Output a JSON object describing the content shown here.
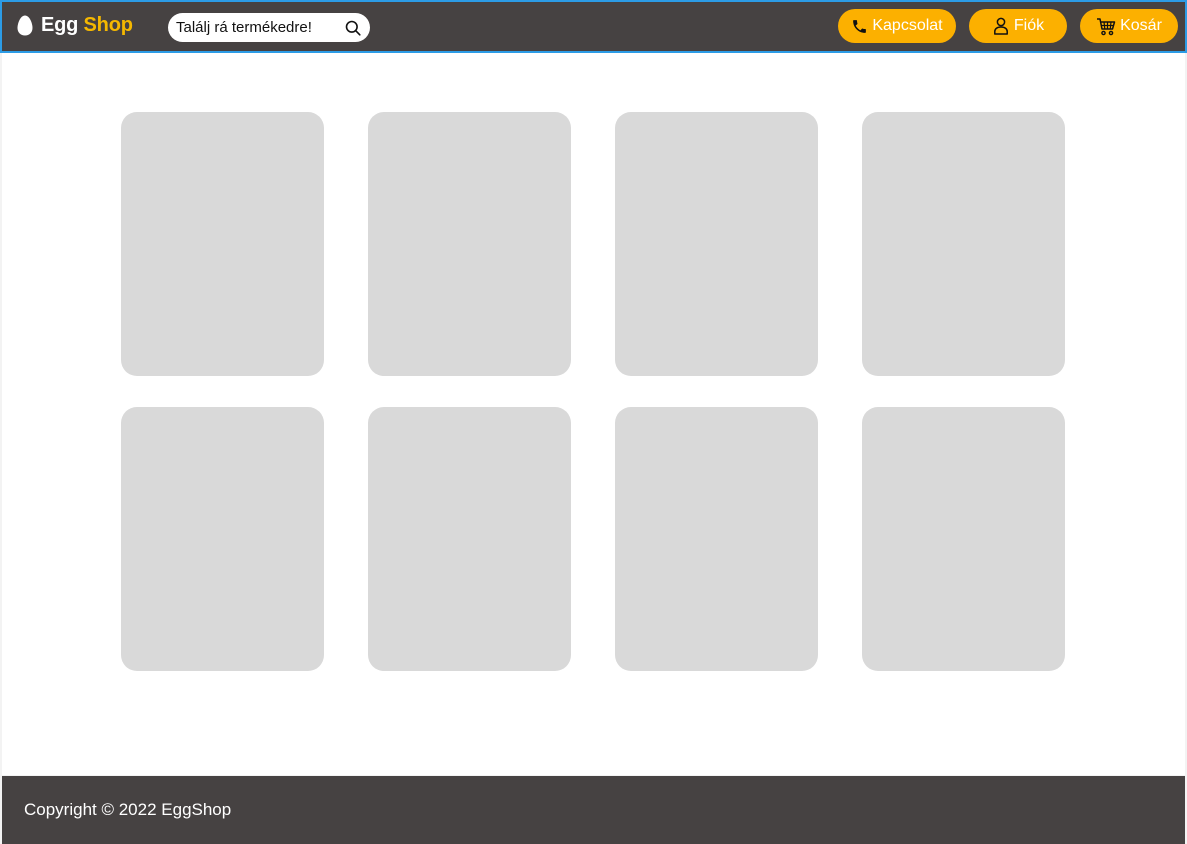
{
  "header": {
    "logo_egg": "Egg",
    "logo_shop": "Shop",
    "logo_icon": "egg-icon",
    "search": {
      "placeholder": "Találj rá termékedre!",
      "icon": "search-icon"
    },
    "buttons": {
      "contact": {
        "label": "Kapcsolat",
        "icon": "phone-icon"
      },
      "account": {
        "label": "Fiók",
        "icon": "user-icon"
      },
      "cart": {
        "label": "Kosár",
        "icon": "cart-icon"
      }
    }
  },
  "product_cards": 8,
  "footer": {
    "copyright": "Copyright © 2022 EggShop"
  },
  "colors": {
    "header_bg": "#464242",
    "accent": "#fcb000",
    "logo_shop": "#f5b800",
    "card_placeholder": "#d9d9d9",
    "header_border": "#2c9ce6"
  }
}
